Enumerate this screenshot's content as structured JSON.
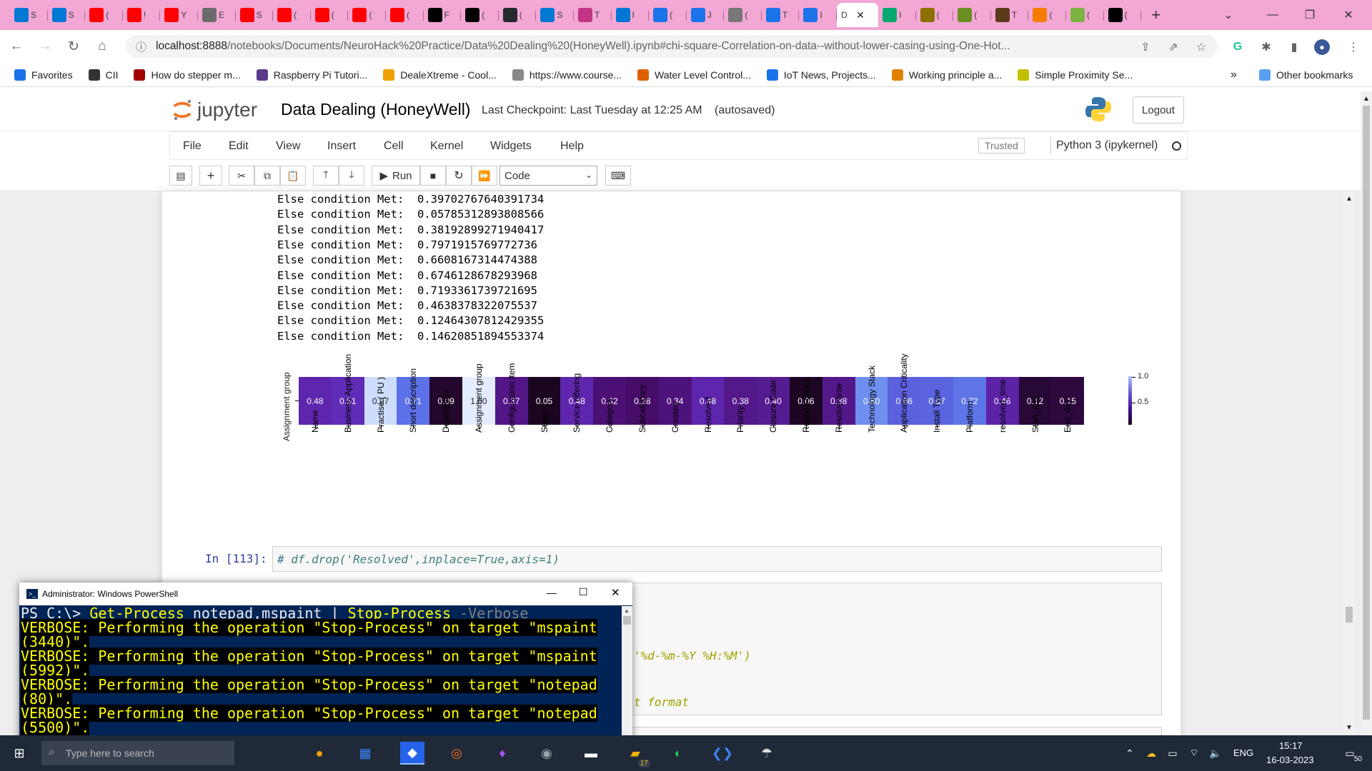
{
  "browser": {
    "tabs": [
      {
        "label": "S",
        "icon": "windows-icon",
        "color": "#0078d4"
      },
      {
        "label": "S",
        "icon": "windows-icon",
        "color": "#0078d4"
      },
      {
        "label": "(",
        "icon": "youtube-icon",
        "color": "#ff0000"
      },
      {
        "label": "!",
        "icon": "youtube-icon",
        "color": "#ff0000"
      },
      {
        "label": "Y",
        "icon": "youtube-icon",
        "color": "#ff0000"
      },
      {
        "label": "E",
        "icon": "wordpress-icon",
        "color": "#6b6b6b"
      },
      {
        "label": "S",
        "icon": "youtube-icon",
        "color": "#ff0000"
      },
      {
        "label": "(",
        "icon": "youtube-icon",
        "color": "#ff0000"
      },
      {
        "label": "(",
        "icon": "youtube-icon",
        "color": "#ff0000"
      },
      {
        "label": "(",
        "icon": "youtube-icon",
        "color": "#ff0000"
      },
      {
        "label": "(",
        "icon": "youtube-icon",
        "color": "#ff0000"
      },
      {
        "label": "F",
        "icon": "medium-icon",
        "color": "#000000"
      },
      {
        "label": "(",
        "icon": "medium-icon",
        "color": "#000000"
      },
      {
        "label": "(",
        "icon": "github-icon",
        "color": "#24292e"
      },
      {
        "label": "S",
        "icon": "windows-icon",
        "color": "#0078d4"
      },
      {
        "label": "T",
        "icon": "instagram-icon",
        "color": "#c13584"
      },
      {
        "label": "I",
        "icon": "windows-icon",
        "color": "#0078d4"
      },
      {
        "label": "(",
        "icon": "loading-icon",
        "color": "#1a73e8"
      },
      {
        "label": "J",
        "icon": "docs-icon",
        "color": "#1a73e8"
      },
      {
        "label": "(",
        "icon": "globe-icon",
        "color": "#777777"
      },
      {
        "label": "T",
        "icon": "docs-icon",
        "color": "#1a73e8"
      },
      {
        "label": "I",
        "icon": "loading-icon",
        "color": "#1a73e8"
      }
    ],
    "active_tab": {
      "label": "D"
    },
    "tabs_after": [
      {
        "label": "I",
        "icon": "w3schools-icon",
        "color": "#04aa6d"
      },
      {
        "label": "(",
        "icon": "notebook-icon",
        "color": "#8d6e00"
      },
      {
        "label": "(",
        "icon": "sage-icon",
        "color": "#6b8e23"
      },
      {
        "label": "T",
        "icon": "tds-icon",
        "color": "#5d3a1a"
      },
      {
        "label": "(",
        "icon": "k-icon",
        "color": "#f57c00"
      },
      {
        "label": "(",
        "icon": "gv-icon",
        "color": "#7cb342"
      },
      {
        "label": "(",
        "icon": "medium-icon",
        "color": "#000000"
      }
    ],
    "url_host": "localhost:8888",
    "url_path": "/notebooks/Documents/NeuroHack%20Practice/Data%20Dealing%20(HoneyWell).ipynb#chi-square-Correlation-on-data--without-lower-casing-using-One-Hot...",
    "bookmarks": [
      {
        "label": "Favorites",
        "color": "#1a73e8"
      },
      {
        "label": "CII",
        "color": "#333333"
      },
      {
        "label": "How do stepper m...",
        "color": "#a00000"
      },
      {
        "label": "Raspberry Pi Tutori...",
        "color": "#5a3a8a"
      },
      {
        "label": "DealeXtreme - Cool...",
        "color": "#f0a000"
      },
      {
        "label": "https://www.course...",
        "color": "#888888"
      },
      {
        "label": "Water Level Control...",
        "color": "#e06000"
      },
      {
        "label": "IoT News, Projects...",
        "color": "#1a73e8"
      },
      {
        "label": "Working principle a...",
        "color": "#e08000"
      },
      {
        "label": "Simple Proximity Se...",
        "color": "#c0c000"
      }
    ],
    "bookmarks_more": "»",
    "other_bookmarks": "Other bookmarks"
  },
  "jupyter": {
    "logo_text": "jupyter",
    "notebook_title": "Data Dealing (HoneyWell)",
    "checkpoint": "Last Checkpoint: Last Tuesday at 12:25 AM",
    "autosaved": "(autosaved)",
    "logout": "Logout",
    "menus": [
      "File",
      "Edit",
      "View",
      "Insert",
      "Cell",
      "Kernel",
      "Widgets",
      "Help"
    ],
    "trusted": "Trusted",
    "kernel": "Python 3 (ipykernel)",
    "run_label": "Run",
    "cell_type": "Code"
  },
  "output": {
    "lines": [
      "Else condition Met:  0.397027676403917​34",
      "Else condition Met:  0.05785312893808566",
      "Else condition Met:  0.38192899271940417",
      "Else condition Met:  0.7971915769772736",
      "Else condition Met:  0.6608167314474388",
      "Else condition Met:  0.6746128678293968",
      "Else condition Met:  0.7193361739721695",
      "Else condition Met:  0.4638378322075537",
      "Else condition Met:  0.12464307812429355",
      "Else condition Met:  0.14620851894553374"
    ]
  },
  "chart_data": {
    "type": "heatmap",
    "ylabel": "Assignment group",
    "categories": [
      "Name",
      "Business Application",
      "Practise ( PU )",
      "Short description",
      "Description",
      "Assignment group",
      "Configuration item",
      "State",
      "Service offering",
      "Category",
      "Subcategory",
      "Created",
      "Resolved",
      "Priority",
      "Closure Code",
      "Reopen count",
      "Resolve time",
      "Technology Stack",
      "Application Criticality",
      "Install Type",
      "Platform",
      "resolved_time",
      "Start_day",
      "End_day"
    ],
    "values": [
      0.48,
      0.51,
      0.97,
      0.71,
      0.09,
      1.0,
      0.37,
      0.05,
      0.48,
      0.32,
      0.28,
      0.34,
      0.48,
      0.38,
      0.4,
      0.06,
      0.38,
      0.8,
      0.66,
      0.67,
      0.72,
      0.46,
      0.12,
      0.15
    ],
    "labels": [
      "0.48",
      "0.51",
      "0.97",
      "0.71",
      "0.09",
      "1.00",
      "0.37",
      "0.05",
      "0.48",
      "0.32",
      "0.28",
      "0.34",
      "0.48",
      "0.38",
      "0.40",
      "0.06",
      "0.38",
      "0.80",
      "0.66",
      "0.67",
      "0.72",
      "0.46",
      "0.12",
      "0.15"
    ],
    "colorbar_ticks": [
      "1.0",
      "0.5"
    ],
    "colormap": "cmap from near-black (low) through purple to light blue (high)"
  },
  "cells": {
    "prompt": "In [113]:",
    "code1": "# df.drop('Resolved',inplace=True,axis=1)",
    "code2_line1": "'%d-%m-%Y %H:%M')",
    "code2_line2": "t format"
  },
  "powershell": {
    "title": "Administrator: Windows PowerShell",
    "prompt1": "PS C:\\> ",
    "cmd1": "Get-Process",
    "arg1": " notepad,mspaint | ",
    "cmd2": "Stop-Process",
    "flag": " -Verbose",
    "verbose": [
      "VERBOSE: Performing the operation \"Stop-Process\" on target \"mspaint",
      "(3440)\".",
      "VERBOSE: Performing the operation \"Stop-Process\" on target \"mspaint",
      "(5992)\".",
      "VERBOSE: Performing the operation \"Stop-Process\" on target \"notepad",
      "(80)\".",
      "VERBOSE: Performing the operation \"Stop-Process\" on target \"notepad",
      "(5500)\"."
    ],
    "prompt2": "PS C:\\> "
  },
  "taskbar": {
    "search_text": "Type here to search",
    "lang": "ENG",
    "time": "15:17",
    "date": "16-03-2023",
    "notifications": "50",
    "badge": "17"
  }
}
